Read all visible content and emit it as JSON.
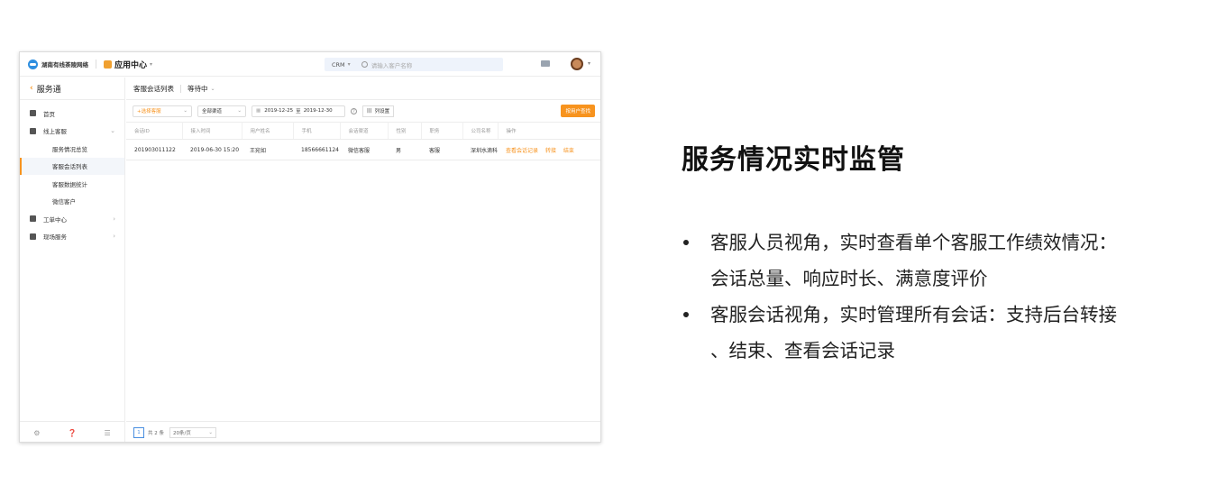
{
  "app": {
    "company": "湖南有线茶陵网络",
    "app_center": "应用中心",
    "crm": "CRM",
    "search_placeholder": "请输入客户名称"
  },
  "sidebar": {
    "title": "服务通",
    "items": [
      {
        "label": "首页"
      },
      {
        "label": "线上客服"
      },
      {
        "label": "服务情况总览"
      },
      {
        "label": "客服会话列表"
      },
      {
        "label": "客服数据统计"
      },
      {
        "label": "微信客户"
      },
      {
        "label": "工单中心"
      },
      {
        "label": "现场服务"
      }
    ]
  },
  "tabs": {
    "list": "客服会话列表",
    "status": "等待中"
  },
  "filters": {
    "agent": "+选择客服",
    "channel": "全部渠道",
    "date_from": "2019-12-25",
    "date_to_sep": "至",
    "date_to": "2019-12-30",
    "column_settings": "列设置",
    "user_query": "按用户查找"
  },
  "table": {
    "headers": [
      "会话ID",
      "接入时间",
      "用户姓名",
      "手机",
      "会话渠道",
      "性别",
      "职务",
      "公司名称",
      "操作"
    ],
    "rows": [
      {
        "id": "201903011122",
        "time": "2019-06-30 15:20",
        "name": "王宛如",
        "phone": "18566661124",
        "channel": "微信客服",
        "gender": "男",
        "role": "客服",
        "company": "深圳水滴科"
      }
    ],
    "actions": [
      "查看会话记录",
      "转接",
      "结束"
    ]
  },
  "pager": {
    "page": "1",
    "total": "共 2 条",
    "size": "20条/页"
  },
  "slide": {
    "title": "服务情况实时监管",
    "bullet1_line1": "客服人员视角，实时查看单个客服工作绩效情况：",
    "bullet1_line2": "会话总量、响应时长、满意度评价",
    "bullet2_line1": "客服会话视角，实时管理所有会话：支持后台转接",
    "bullet2_line2": "、结束、查看会话记录"
  }
}
